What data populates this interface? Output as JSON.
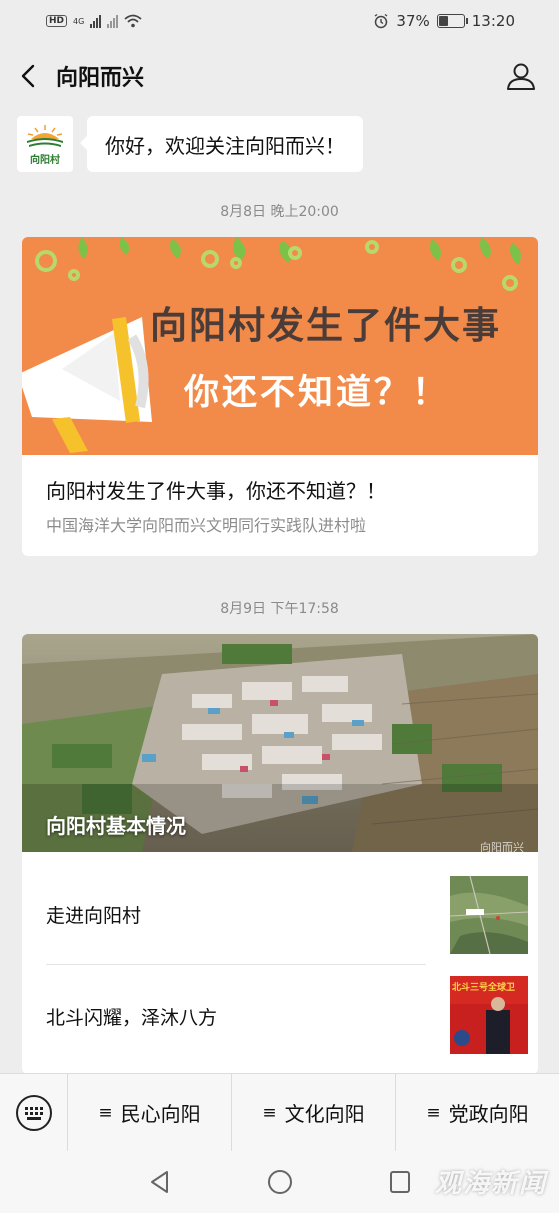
{
  "status_bar": {
    "hd_label": "HD",
    "network_label": "4G",
    "battery_percent": "37%",
    "battery_level": 0.37,
    "time": "13:20",
    "icons": [
      "signal-icon",
      "wifi-icon",
      "alarm-icon",
      "battery-icon"
    ]
  },
  "nav": {
    "title": "向阳而兴",
    "icons": [
      "back-arrow-icon",
      "user-profile-icon"
    ]
  },
  "greeting": {
    "avatar_text": "向阳村",
    "message": "你好，欢迎关注向阳而兴！"
  },
  "messages": [
    {
      "timestamp": "8月8日 晚上20:00",
      "banner_line1": "向阳村发生了件大事",
      "banner_line2": "你还不知道？！",
      "title": "向阳村发生了件大事，你还不知道？！",
      "subtitle": "中国海洋大学向阳而兴文明同行实践队进村啦"
    },
    {
      "timestamp": "8月9日 下午17:58",
      "cover_caption": "向阳村基本情况",
      "cover_watermark": "向阳而兴",
      "sub_items": [
        {
          "label": "走进向阳村"
        },
        {
          "label": "北斗闪耀，泽沐八方",
          "thumb_text": "北斗三号全球卫"
        }
      ]
    }
  ],
  "menu": {
    "items": [
      {
        "icon": "≡",
        "label": "民心向阳"
      },
      {
        "icon": "≡",
        "label": "文化向阳"
      },
      {
        "icon": "≡",
        "label": "党政向阳"
      }
    ]
  },
  "watermark": "观海新闻",
  "colors": {
    "banner_orange": "#f28a4a",
    "brand_green": "#2e7d32",
    "background": "#ededed"
  }
}
